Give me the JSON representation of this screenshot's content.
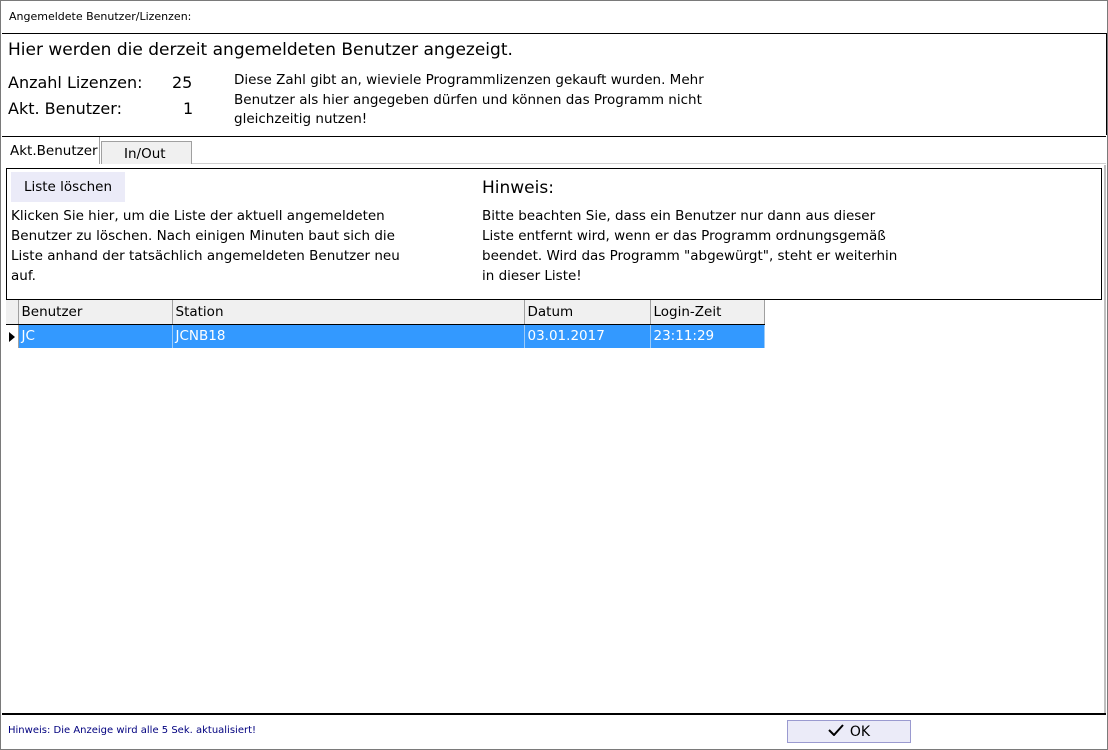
{
  "window": {
    "title": "Angemeldete Benutzer/Lizenzen:"
  },
  "header": {
    "title": "Hier werden die derzeit angemeldeten Benutzer angezeigt.",
    "licenses_label": "Anzahl Lizenzen:",
    "licenses_value": "25",
    "users_label": "Akt. Benutzer:",
    "users_value": "1",
    "description": "Diese Zahl gibt an, wieviele Programmlizenzen gekauft wurden. Mehr Benutzer als hier angegeben dürfen und können das Programm nicht gleichzeitig nutzen!"
  },
  "tabs": [
    {
      "label": "Akt.Benutzer",
      "active": true
    },
    {
      "label": "In/Out",
      "active": false
    }
  ],
  "info": {
    "clear_button": "Liste löschen",
    "clear_description": "Klicken Sie hier, um die Liste der aktuell angemeldeten Benutzer zu löschen.  Nach einigen Minuten baut sich die Liste anhand der tatsächlich angemeldeten Benutzer neu auf.",
    "hint_title": "Hinweis:",
    "hint_text": "Bitte beachten Sie, dass ein Benutzer nur dann aus dieser Liste entfernt wird, wenn er das Programm ordnungsgemäß beendet. Wird das Programm \"abgewürgt\", steht er weiterhin in dieser Liste!"
  },
  "grid": {
    "columns": [
      "Benutzer",
      "Station",
      "Datum",
      "Login-Zeit"
    ],
    "rows": [
      {
        "benutzer": "JC",
        "station": "JCNB18",
        "datum": "03.01.2017",
        "login_zeit": "23:11:29"
      }
    ]
  },
  "footer": {
    "hint": "Hinweis: Die Anzeige wird alle 5 Sek. aktualisiert!",
    "ok_label": "OK"
  },
  "colors": {
    "selection": "#3399ff",
    "button_bg": "#ebebf8",
    "footer_text": "#00007f"
  }
}
